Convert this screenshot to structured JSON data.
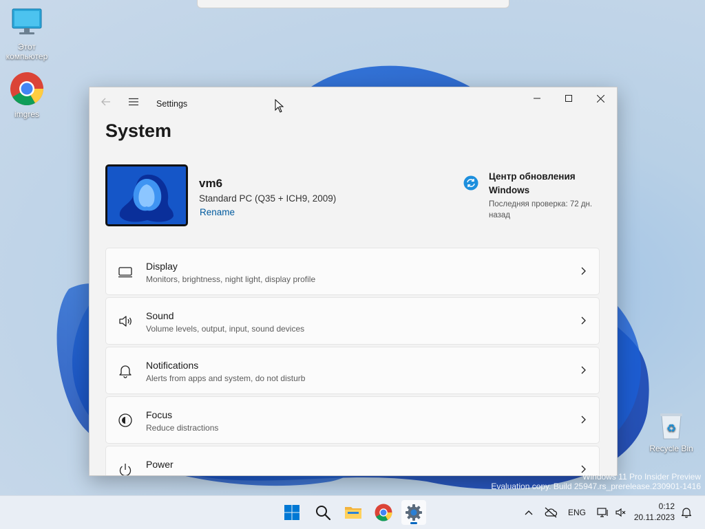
{
  "desktop": {
    "icons": [
      {
        "label": "Этот компьютер"
      },
      {
        "label": "imgres"
      },
      {
        "label": "Recycle Bin"
      }
    ],
    "watermark": {
      "line1": "Windows 11 Pro Insider Preview",
      "line2": "Evaluation copy. Build 25947.rs_prerelease.230901-1416"
    }
  },
  "window": {
    "app_title": "Settings",
    "page_title": "System",
    "device": {
      "name": "vm6",
      "model": "Standard PC (Q35 + ICH9, 2009)",
      "rename_label": "Rename"
    },
    "update": {
      "title": "Центр обновления Windows",
      "subtitle": "Последняя проверка: 72 дн. назад"
    },
    "rows": [
      {
        "title": "Display",
        "subtitle": "Monitors, brightness, night light, display profile",
        "icon": "display-icon"
      },
      {
        "title": "Sound",
        "subtitle": "Volume levels, output, input, sound devices",
        "icon": "speaker-icon"
      },
      {
        "title": "Notifications",
        "subtitle": "Alerts from apps and system, do not disturb",
        "icon": "bell-icon"
      },
      {
        "title": "Focus",
        "subtitle": "Reduce distractions",
        "icon": "focus-icon"
      },
      {
        "title": "Power",
        "subtitle": "",
        "icon": "power-icon"
      }
    ]
  },
  "taskbar": {
    "apps": [
      "start",
      "search",
      "file-explorer",
      "chrome",
      "settings"
    ],
    "tray": {
      "language": "ENG",
      "time": "0:12",
      "date": "20.11.2023"
    }
  },
  "colors": {
    "accent": "#0067c0",
    "link": "#005a9e",
    "window_bg": "#f3f3f3",
    "card_bg": "#fbfbfb"
  }
}
